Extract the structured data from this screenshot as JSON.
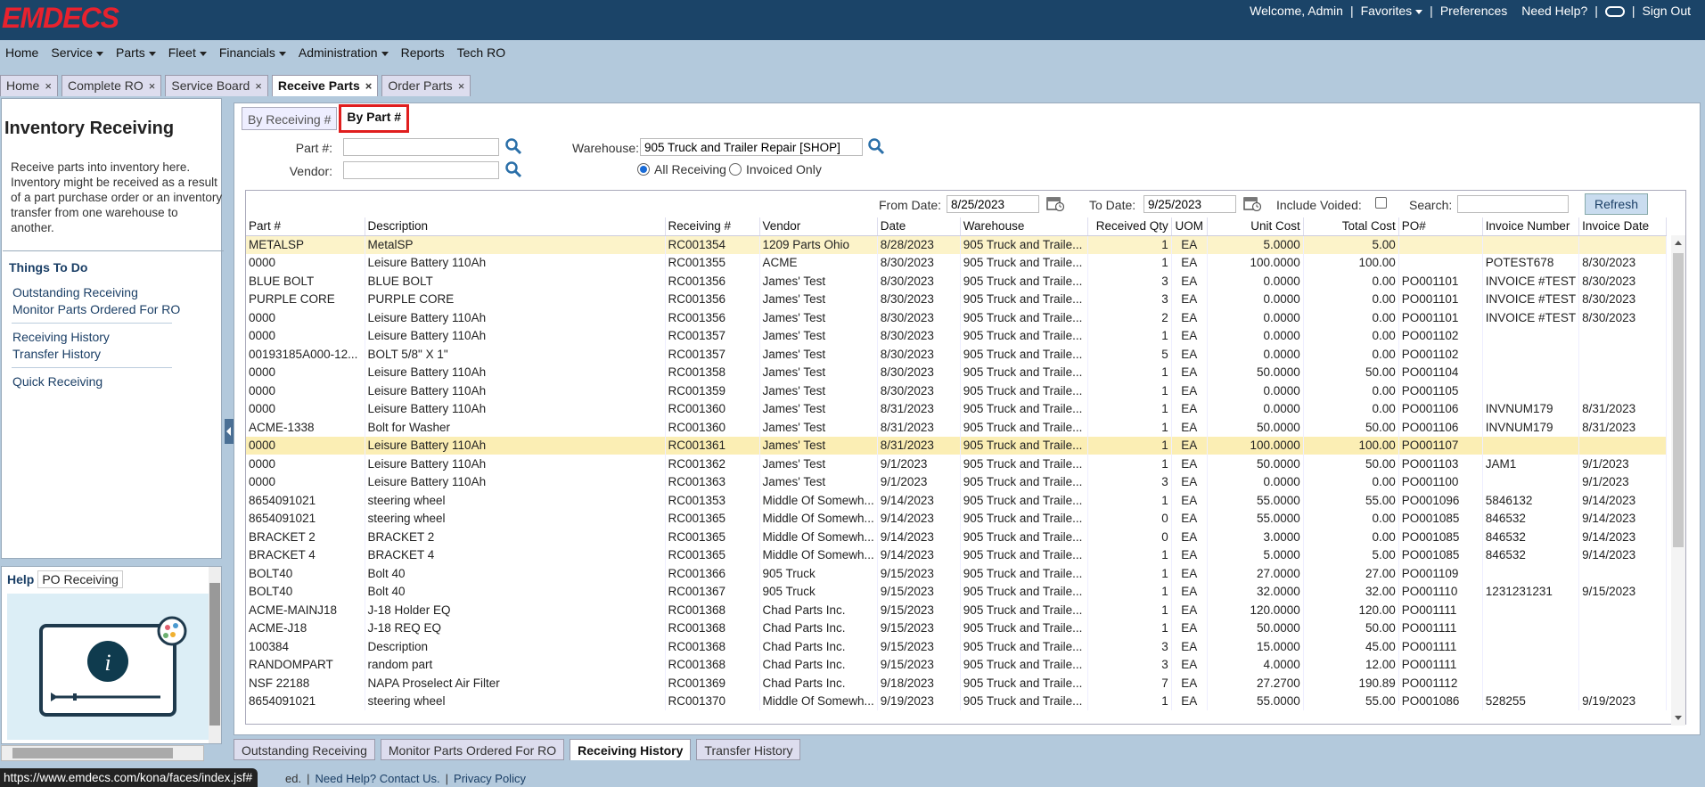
{
  "brand": {
    "logo_text": "EMDECS",
    "logo_color": "#e8222e"
  },
  "top": {
    "welcome": "Welcome, Admin",
    "favorites": "Favorites",
    "preferences": "Preferences",
    "need_help": "Need Help?",
    "sign_out": "Sign Out"
  },
  "menu": {
    "home": "Home",
    "service": "Service",
    "parts": "Parts",
    "fleet": "Fleet",
    "financials": "Financials",
    "administration": "Administration",
    "reports": "Reports",
    "tech_ro": "Tech RO"
  },
  "page_tabs": [
    "Home",
    "Complete RO",
    "Service Board",
    "Receive Parts",
    "Order Parts"
  ],
  "close_glyph": "×",
  "left": {
    "title": "Inventory Receiving",
    "description": "Receive parts into inventory here. Inventory might be received as a result of a part purchase order or an inventory transfer from one warehouse to another.",
    "todo_title": "Things To Do",
    "links": {
      "outstanding": "Outstanding Receiving",
      "monitor": "Monitor Parts Ordered For RO",
      "history": "Receiving History",
      "transfer": "Transfer History",
      "quick": "Quick Receiving"
    },
    "help_label": "Help",
    "help_topic": "PO Receiving"
  },
  "subtabs": [
    "By Receiving #",
    "By Part #"
  ],
  "filters": {
    "part_label": "Part #:",
    "vendor_label": "Vendor:",
    "warehouse_label": "Warehouse:",
    "warehouse_value": "905 Truck and Trailer Repair [SHOP]",
    "part_value": "",
    "vendor_value": "",
    "radio_all": "All Receiving",
    "radio_invoiced": "Invoiced Only"
  },
  "grid_toolbar": {
    "from_label": "From Date:",
    "from_value": "8/25/2023",
    "to_label": "To Date:",
    "to_value": "9/25/2023",
    "voided_label": "Include Voided:",
    "search_label": "Search:",
    "search_value": "",
    "refresh": "Refresh"
  },
  "table": {
    "columns": [
      "Part #",
      "Description",
      "Receiving #",
      "Vendor",
      "Date",
      "Warehouse",
      "Received Qty",
      "UOM",
      "Unit Cost",
      "Total Cost",
      "PO#",
      "Invoice Number",
      "Invoice Date"
    ],
    "rows": [
      [
        "METALSP",
        "MetalSP",
        "RC001354",
        "1209 Parts Ohio",
        "8/28/2023",
        "905 Truck and Traile...",
        "1",
        "EA",
        "5.0000",
        "5.00",
        "",
        "",
        ""
      ],
      [
        "0000",
        "Leisure Battery 110Ah",
        "RC001355",
        "ACME",
        "8/30/2023",
        "905 Truck and Traile...",
        "1",
        "EA",
        "100.0000",
        "100.00",
        "",
        "POTEST678",
        "8/30/2023"
      ],
      [
        "BLUE BOLT",
        "BLUE BOLT",
        "RC001356",
        "James' Test",
        "8/30/2023",
        "905 Truck and Traile...",
        "3",
        "EA",
        "0.0000",
        "0.00",
        "PO001101",
        "INVOICE #TEST",
        "8/30/2023"
      ],
      [
        "PURPLE CORE",
        "PURPLE CORE",
        "RC001356",
        "James' Test",
        "8/30/2023",
        "905 Truck and Traile...",
        "3",
        "EA",
        "0.0000",
        "0.00",
        "PO001101",
        "INVOICE #TEST",
        "8/30/2023"
      ],
      [
        "0000",
        "Leisure Battery 110Ah",
        "RC001356",
        "James' Test",
        "8/30/2023",
        "905 Truck and Traile...",
        "2",
        "EA",
        "0.0000",
        "0.00",
        "PO001101",
        "INVOICE #TEST",
        "8/30/2023"
      ],
      [
        "0000",
        "Leisure Battery 110Ah",
        "RC001357",
        "James' Test",
        "8/30/2023",
        "905 Truck and Traile...",
        "1",
        "EA",
        "0.0000",
        "0.00",
        "PO001102",
        "",
        ""
      ],
      [
        "00193185A000-12...",
        "BOLT 5/8\" X 1\"",
        "RC001357",
        "James' Test",
        "8/30/2023",
        "905 Truck and Traile...",
        "5",
        "EA",
        "0.0000",
        "0.00",
        "PO001102",
        "",
        ""
      ],
      [
        "0000",
        "Leisure Battery 110Ah",
        "RC001358",
        "James' Test",
        "8/30/2023",
        "905 Truck and Traile...",
        "1",
        "EA",
        "50.0000",
        "50.00",
        "PO001104",
        "",
        ""
      ],
      [
        "0000",
        "Leisure Battery 110Ah",
        "RC001359",
        "James' Test",
        "8/30/2023",
        "905 Truck and Traile...",
        "1",
        "EA",
        "0.0000",
        "0.00",
        "PO001105",
        "",
        ""
      ],
      [
        "0000",
        "Leisure Battery 110Ah",
        "RC001360",
        "James' Test",
        "8/31/2023",
        "905 Truck and Traile...",
        "1",
        "EA",
        "0.0000",
        "0.00",
        "PO001106",
        "INVNUM179",
        "8/31/2023"
      ],
      [
        "ACME-1338",
        "Bolt for Washer",
        "RC001360",
        "James' Test",
        "8/31/2023",
        "905 Truck and Traile...",
        "1",
        "EA",
        "50.0000",
        "50.00",
        "PO001106",
        "INVNUM179",
        "8/31/2023"
      ],
      [
        "0000",
        "Leisure Battery 110Ah",
        "RC001361",
        "James' Test",
        "8/31/2023",
        "905 Truck and Traile...",
        "1",
        "EA",
        "100.0000",
        "100.00",
        "PO001107",
        "",
        ""
      ],
      [
        "0000",
        "Leisure Battery 110Ah",
        "RC001362",
        "James' Test",
        "9/1/2023",
        "905 Truck and Traile...",
        "1",
        "EA",
        "50.0000",
        "50.00",
        "PO001103",
        "JAM1",
        "9/1/2023"
      ],
      [
        "0000",
        "Leisure Battery 110Ah",
        "RC001363",
        "James' Test",
        "9/1/2023",
        "905 Truck and Traile...",
        "3",
        "EA",
        "0.0000",
        "0.00",
        "PO001100",
        "",
        "9/1/2023"
      ],
      [
        "8654091021",
        "steering wheel",
        "RC001353",
        "Middle Of Somewh...",
        "9/14/2023",
        "905 Truck and Traile...",
        "1",
        "EA",
        "55.0000",
        "55.00",
        "PO001096",
        "5846132",
        "9/14/2023"
      ],
      [
        "8654091021",
        "steering wheel",
        "RC001365",
        "Middle Of Somewh...",
        "9/14/2023",
        "905 Truck and Traile...",
        "0",
        "EA",
        "55.0000",
        "0.00",
        "PO001085",
        "846532",
        "9/14/2023"
      ],
      [
        "BRACKET 2",
        "BRACKET 2",
        "RC001365",
        "Middle Of Somewh...",
        "9/14/2023",
        "905 Truck and Traile...",
        "0",
        "EA",
        "3.0000",
        "0.00",
        "PO001085",
        "846532",
        "9/14/2023"
      ],
      [
        "BRACKET 4",
        "BRACKET 4",
        "RC001365",
        "Middle Of Somewh...",
        "9/14/2023",
        "905 Truck and Traile...",
        "1",
        "EA",
        "5.0000",
        "5.00",
        "PO001085",
        "846532",
        "9/14/2023"
      ],
      [
        "BOLT40",
        "Bolt 40",
        "RC001366",
        "905 Truck",
        "9/15/2023",
        "905 Truck and Traile...",
        "1",
        "EA",
        "27.0000",
        "27.00",
        "PO001109",
        "",
        ""
      ],
      [
        "BOLT40",
        "Bolt 40",
        "RC001367",
        "905 Truck",
        "9/15/2023",
        "905 Truck and Traile...",
        "1",
        "EA",
        "32.0000",
        "32.00",
        "PO001110",
        "1231231231",
        "9/15/2023"
      ],
      [
        "ACME-MAINJ18",
        "J-18 Holder EQ",
        "RC001368",
        "Chad Parts Inc.",
        "9/15/2023",
        "905 Truck and Traile...",
        "1",
        "EA",
        "120.0000",
        "120.00",
        "PO001111",
        "",
        ""
      ],
      [
        "ACME-J18",
        "J-18 REQ EQ",
        "RC001368",
        "Chad Parts Inc.",
        "9/15/2023",
        "905 Truck and Traile...",
        "1",
        "EA",
        "50.0000",
        "50.00",
        "PO001111",
        "",
        ""
      ],
      [
        "100384",
        "Description",
        "RC001368",
        "Chad Parts Inc.",
        "9/15/2023",
        "905 Truck and Traile...",
        "3",
        "EA",
        "15.0000",
        "45.00",
        "PO001111",
        "",
        ""
      ],
      [
        "RANDOMPART",
        "random part",
        "RC001368",
        "Chad Parts Inc.",
        "9/15/2023",
        "905 Truck and Traile...",
        "3",
        "EA",
        "4.0000",
        "12.00",
        "PO001111",
        "",
        ""
      ],
      [
        "NSF 22188",
        "NAPA Proselect Air Filter",
        "RC001369",
        "Chad Parts Inc.",
        "9/18/2023",
        "905 Truck and Traile...",
        "7",
        "EA",
        "27.2700",
        "190.89",
        "PO001112",
        "",
        ""
      ],
      [
        "8654091021",
        "steering wheel",
        "RC001370",
        "Middle Of Somewh...",
        "9/19/2023",
        "905 Truck and Traile...",
        "1",
        "EA",
        "55.0000",
        "55.00",
        "PO001086",
        "528255",
        "9/19/2023"
      ]
    ]
  },
  "bottom_tabs": [
    "Outstanding Receiving",
    "Monitor Parts Ordered For RO",
    "Receiving History",
    "Transfer History"
  ],
  "footer": {
    "url": "https://www.emdecs.com/kona/faces/index.jsf#",
    "partial": "ed.",
    "help_contact": "Need Help? Contact Us.",
    "privacy": "Privacy Policy"
  }
}
